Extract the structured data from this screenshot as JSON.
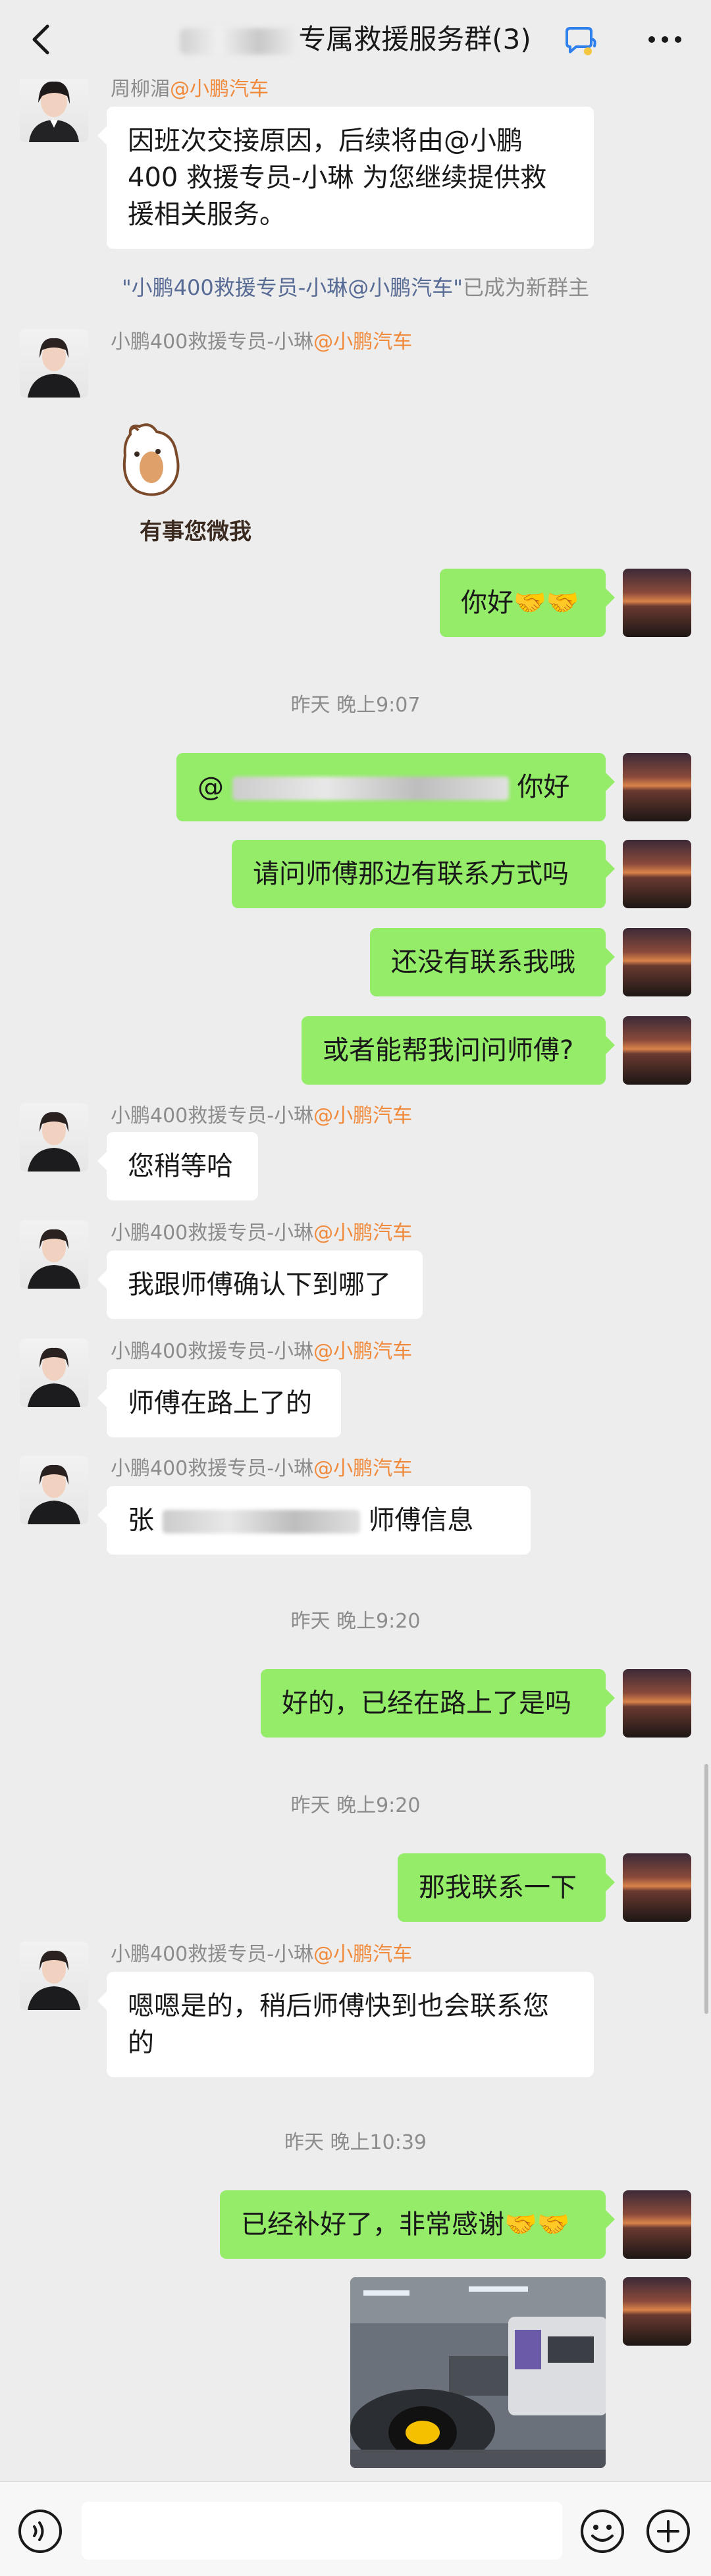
{
  "header": {
    "title_prefix": "",
    "title_suffix": "专属救援服务群(3)",
    "back_icon": "chevron-left-icon",
    "more_icon": "more-icon"
  },
  "system_message": {
    "highlight": "\"小鹏400救援专员-小琳@小鹏汽车\"",
    "rest": "已成为新群主"
  },
  "messages": {
    "m1": {
      "sender_name": "周柳湄",
      "sender_org": "@小鹏汽车",
      "text": "因班次交接原因，后续将由@小鹏400 救援专员-小琳 为您继续提供救援相关服务。"
    },
    "m2": {
      "sender_name": "小鹏400救援专员-小琳",
      "sender_org": "@小鹏汽车",
      "sticker_text": "有事您微我"
    },
    "m3": {
      "text": "你好🤝🤝"
    },
    "t1": {
      "text": "昨天 晚上9:07"
    },
    "m4": {
      "prefix": "@",
      "suffix": "你好"
    },
    "m5": {
      "text": "请问师傅那边有联系方式吗"
    },
    "m6": {
      "text": "还没有联系我哦"
    },
    "m7": {
      "text": "或者能帮我问问师傅?"
    },
    "m8": {
      "sender_name": "小鹏400救援专员-小琳",
      "sender_org": "@小鹏汽车",
      "text": "您稍等哈"
    },
    "m9": {
      "sender_name": "小鹏400救援专员-小琳",
      "sender_org": "@小鹏汽车",
      "text": "我跟师傅确认下到哪了"
    },
    "m10": {
      "sender_name": "小鹏400救援专员-小琳",
      "sender_org": "@小鹏汽车",
      "text": "师傅在路上了的"
    },
    "m11": {
      "sender_name": "小鹏400救援专员-小琳",
      "sender_org": "@小鹏汽车",
      "prefix": "张",
      "suffix": "师傅信息"
    },
    "t2": {
      "text": "昨天 晚上9:20"
    },
    "m12": {
      "text": "好的，已经在路上了是吗"
    },
    "t3": {
      "text": "昨天 晚上9:20"
    },
    "m13": {
      "text": "那我联系一下"
    },
    "m14": {
      "sender_name": "小鹏400救援专员-小琳",
      "sender_org": "@小鹏汽车",
      "text": "嗯嗯是的，稍后师傅快到也会联系您的"
    },
    "t4": {
      "text": "昨天 晚上10:39"
    },
    "m15": {
      "text": "已经补好了，非常感谢🤝🤝"
    }
  },
  "input_bar": {
    "voice_icon": "voice-icon",
    "emoji_icon": "emoji-icon",
    "plus_icon": "plus-icon"
  },
  "colors": {
    "bg": "#ededed",
    "my_bubble": "#95ec69",
    "their_bubble": "#ffffff",
    "org_tag": "#f08a3c",
    "link": "#576b95"
  }
}
